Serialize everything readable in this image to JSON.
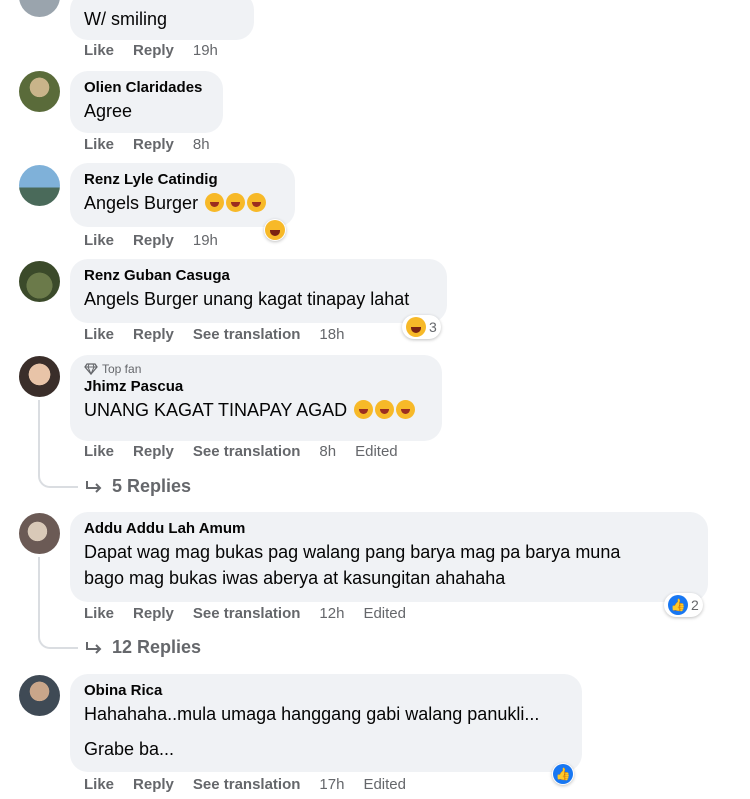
{
  "comments": [
    {
      "name": "",
      "text": "W/ smiling",
      "time": "19h"
    },
    {
      "name": "Olien Claridades",
      "text": "Agree",
      "time": "8h"
    },
    {
      "name": "Renz Lyle Catindig",
      "text": "Angels Burger",
      "time": "19h"
    },
    {
      "name": "Renz Guban Casuga",
      "text": "Angels Burger unang kagat tinapay lahat",
      "time": "18h",
      "reaction_count": "3"
    },
    {
      "badge": "Top fan",
      "name": "Jhimz Pascua",
      "text": "UNANG KAGAT TINAPAY AGAD",
      "time": "8h",
      "edited": "Edited",
      "replies": "5 Replies"
    },
    {
      "name": "Addu Addu Lah Amum",
      "text_lines": [
        "Dapat wag mag bukas pag walang pang barya mag pa barya muna",
        "bago mag bukas iwas aberya at kasungitan ahahaha"
      ],
      "time": "12h",
      "edited": "Edited",
      "reaction_count": "2",
      "replies": "12 Replies"
    },
    {
      "name": "Obina Rica",
      "text_lines": [
        "Hahahaha..mula umaga hanggang gabi walang panukli...",
        "Grabe ba..."
      ],
      "time": "17h",
      "edited": "Edited"
    }
  ],
  "actions": {
    "like": "Like",
    "reply": "Reply",
    "translate": "See translation"
  },
  "icons": {
    "reply_arrow": "reply-arrow-icon",
    "top_fan": "diamond-icon",
    "haha": "haha-reaction-icon",
    "like": "like-reaction-icon"
  },
  "colors": {
    "bubble": "#f0f2f5",
    "meta": "#65676b",
    "like_blue": "#1877f2",
    "emoji_yellow": "#f7b928"
  }
}
